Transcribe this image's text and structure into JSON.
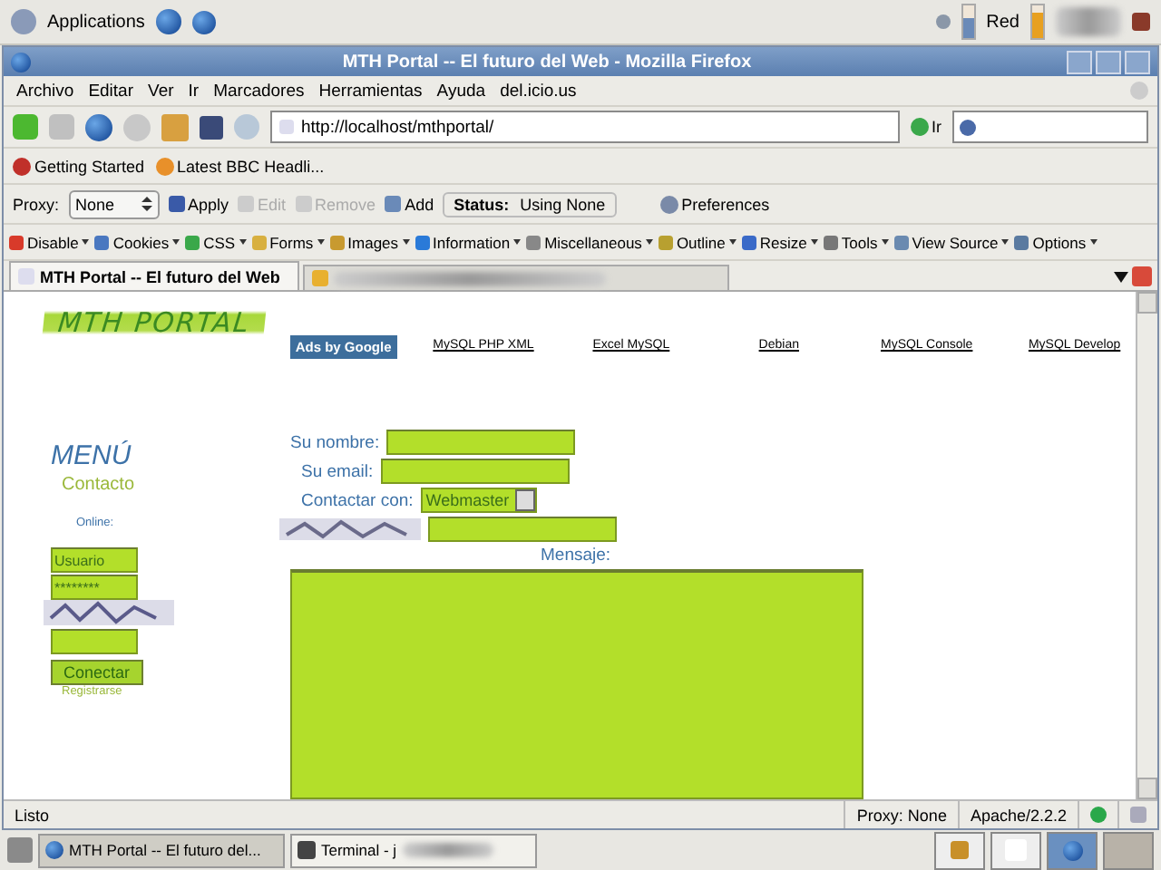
{
  "top_panel": {
    "applications": "Applications",
    "network_label": "Red"
  },
  "window": {
    "title": "MTH Portal -- El futuro del Web - Mozilla Firefox"
  },
  "menu": [
    "Archivo",
    "Editar",
    "Ver",
    "Ir",
    "Marcadores",
    "Herramientas",
    "Ayuda",
    "del.icio.us"
  ],
  "nav": {
    "url": "http://localhost/mthportal/",
    "go": "Ir"
  },
  "bookmarks": [
    "Getting Started",
    "Latest BBC Headli..."
  ],
  "proxy_bar": {
    "label": "Proxy:",
    "value": "None",
    "buttons": [
      {
        "label": "Apply",
        "disabled": false
      },
      {
        "label": "Edit",
        "disabled": true
      },
      {
        "label": "Remove",
        "disabled": true
      },
      {
        "label": "Add",
        "disabled": false
      }
    ],
    "status_label": "Status:",
    "status_value": "Using None",
    "preferences": "Preferences"
  },
  "devtools": [
    "Disable",
    "Cookies",
    "CSS",
    "Forms",
    "Images",
    "Information",
    "Miscellaneous",
    "Outline",
    "Resize",
    "Tools",
    "View Source",
    "Options"
  ],
  "tabs": [
    {
      "label": "MTH Portal -- El futuro del Web",
      "selected": true
    },
    {
      "selected": false
    }
  ],
  "page": {
    "logo": "MTH PORTAL",
    "ads_label": "Ads by Google",
    "ad_links": [
      "MySQL PHP XML",
      "Excel MySQL",
      "Debian",
      "MySQL Console",
      "MySQL Develop"
    ],
    "menu_title": "MENÚ",
    "menu_items": [
      "Contacto"
    ],
    "online": "Online:",
    "login": {
      "user": "Usuario",
      "password": "********",
      "button": "Conectar",
      "register": "Registrarse"
    },
    "form": {
      "fields": [
        {
          "kind": "text",
          "label": "Su nombre:"
        },
        {
          "kind": "text",
          "label": "Su email:"
        },
        {
          "kind": "select",
          "label": "Contactar con:",
          "value": "Webmaster"
        },
        {
          "kind": "captcha"
        }
      ],
      "message_label": "Mensaje:"
    }
  },
  "status_bar": {
    "text": "Listo",
    "proxy": "Proxy: None",
    "server": "Apache/2.2.2"
  },
  "taskbar": [
    {
      "label": "MTH Portal -- El futuro del...",
      "selected": true
    },
    {
      "label": "Terminal - j",
      "selected": false
    }
  ]
}
